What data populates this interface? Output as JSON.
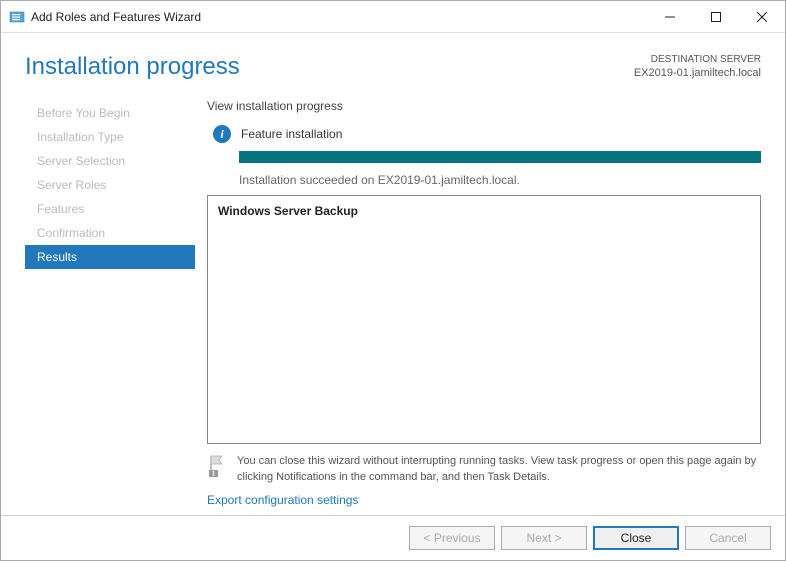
{
  "window": {
    "title": "Add Roles and Features Wizard"
  },
  "header": {
    "page_title": "Installation progress",
    "dest_label": "DESTINATION SERVER",
    "dest_server": "EX2019-01.jamiltech.local"
  },
  "sidebar": {
    "items": [
      {
        "label": "Before You Begin"
      },
      {
        "label": "Installation Type"
      },
      {
        "label": "Server Selection"
      },
      {
        "label": "Server Roles"
      },
      {
        "label": "Features"
      },
      {
        "label": "Confirmation"
      },
      {
        "label": "Results"
      }
    ]
  },
  "main": {
    "progress_label": "View installation progress",
    "feature_label": "Feature installation",
    "status_text": "Installation succeeded on EX2019-01.jamiltech.local.",
    "results_item": "Windows Server Backup",
    "hint_text": "You can close this wizard without interrupting running tasks. View task progress or open this page again by clicking Notifications in the command bar, and then Task Details.",
    "export_link": "Export configuration settings"
  },
  "footer": {
    "previous": "< Previous",
    "next": "Next >",
    "close": "Close",
    "cancel": "Cancel"
  }
}
